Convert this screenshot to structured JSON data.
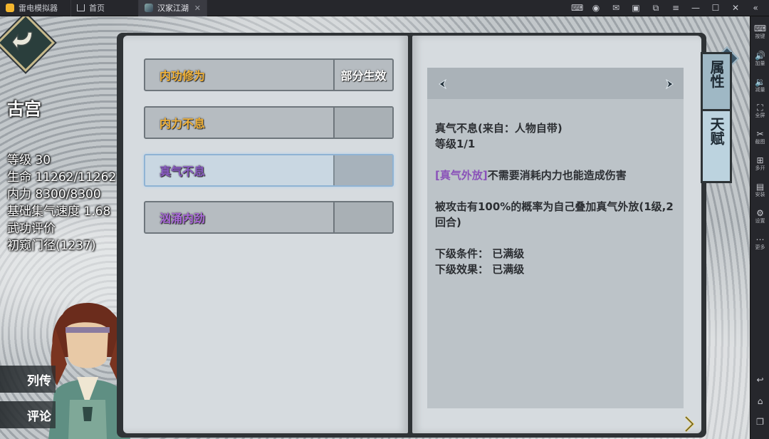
{
  "app": {
    "name": "雷电模拟器",
    "tabs": [
      {
        "label": "首页"
      },
      {
        "label": "汉家江湖"
      }
    ]
  },
  "emulator_sidebar": [
    {
      "icon": "keyboard-icon",
      "label": "按键"
    },
    {
      "icon": "volume-up-icon",
      "label": "加量"
    },
    {
      "icon": "volume-down-icon",
      "label": "减量"
    },
    {
      "icon": "fullscreen-icon",
      "label": "全屏"
    },
    {
      "icon": "scissors-icon",
      "label": "截图"
    },
    {
      "icon": "multi-open-icon",
      "label": "多开"
    },
    {
      "icon": "apk-install-icon",
      "label": "安装"
    },
    {
      "icon": "settings-icon",
      "label": "设置"
    },
    {
      "icon": "more-icon",
      "label": "更多"
    }
  ],
  "character": {
    "name": "古宫",
    "stats": [
      "等级 30",
      "生命 11262/11262",
      "内力 8300/8300",
      "基础集气速度 1.68",
      "武功评价",
      "初窥门径(1237)"
    ],
    "buttons": {
      "biography": "列传",
      "comment": "评论"
    }
  },
  "skills": [
    {
      "name": "内功修为",
      "status": "部分生效",
      "color": "#f0b23a"
    },
    {
      "name": "内力不息",
      "status": "",
      "color": "#f0b23a"
    },
    {
      "name": "真气不息",
      "status": "",
      "color": "#8a5cc4"
    },
    {
      "name": "汹涌内劲",
      "status": "",
      "color": "#a96ad8"
    }
  ],
  "detail": {
    "title": "真气不息(来自：人物自带)",
    "level": "等级1/1",
    "effect_tag": "[真气外放]",
    "effect_text": "不需要消耗内力也能造成伤害",
    "passive": "被攻击有100%的概率为自己叠加真气外放(1级,2回合)",
    "next_condition": "下级条件：  已满级",
    "next_effect": "下级效果：  已满级"
  },
  "side_tabs": {
    "attr": "属性",
    "talent": "天赋"
  },
  "help_label": "?"
}
